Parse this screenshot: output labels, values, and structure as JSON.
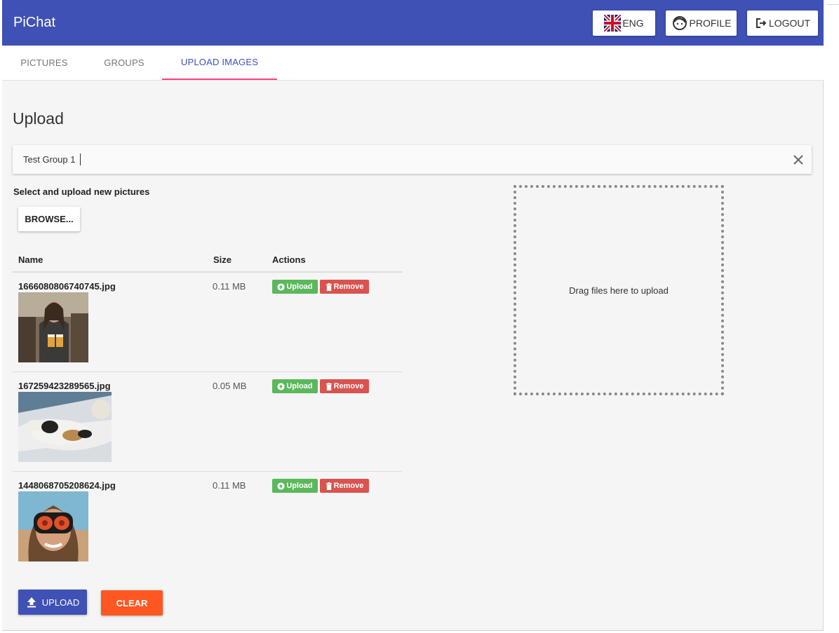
{
  "app": {
    "title": "PiChat"
  },
  "header": {
    "language_label": "ENG",
    "profile_label": "PROFILE",
    "logout_label": "LOGOUT"
  },
  "tabs": [
    {
      "label": "PICTURES",
      "active": false
    },
    {
      "label": "GROUPS",
      "active": false
    },
    {
      "label": "UPLOAD IMAGES",
      "active": true
    }
  ],
  "upload": {
    "title": "Upload",
    "group_value": "Test Group 1",
    "select_label": "Select and upload new pictures",
    "browse_label": "BROWSE...",
    "table": {
      "headers": {
        "name": "Name",
        "size": "Size",
        "actions": "Actions"
      },
      "rows": [
        {
          "name": "1666080806740745.jpg",
          "size": "0.11 MB",
          "upload_label": "Upload",
          "remove_label": "Remove"
        },
        {
          "name": "167259423289565.jpg",
          "size": "0.05 MB",
          "upload_label": "Upload",
          "remove_label": "Remove"
        },
        {
          "name": "1448068705208624.jpg",
          "size": "0.11 MB",
          "upload_label": "Upload",
          "remove_label": "Remove"
        }
      ]
    },
    "dropzone_text": "Drag files here to upload",
    "upload_all_label": "UPLOAD",
    "clear_label": "CLEAR"
  },
  "colors": {
    "primary": "#3f51b5",
    "accent": "#ff4081",
    "success": "#5cb85c",
    "danger": "#d9534f",
    "clear": "#ff5722"
  }
}
